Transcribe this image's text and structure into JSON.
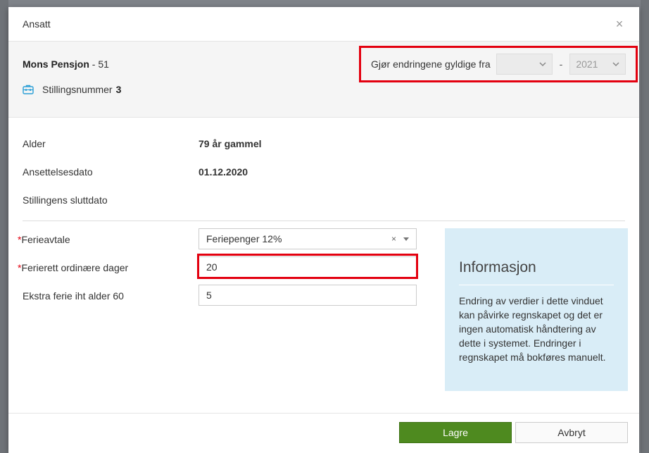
{
  "modal": {
    "title": "Ansatt",
    "close_symbol": "×"
  },
  "employee": {
    "name": "Mons Pensjon",
    "number_suffix": " - 51",
    "position_label": "Stillingsnummer",
    "position_number": "3"
  },
  "validity": {
    "label": "Gjør endringene gyldige fra",
    "month_value": "",
    "separator": "-",
    "year_value": "2021"
  },
  "details": [
    {
      "label": "Alder",
      "value": "79 år gammel"
    },
    {
      "label": "Ansettelsesdato",
      "value": "01.12.2020"
    },
    {
      "label": "Stillingens sluttdato",
      "value": ""
    }
  ],
  "form": {
    "ferieavtale": {
      "label": "Ferieavtale",
      "value": "Feriepenger 12%",
      "clear": "×"
    },
    "ferierett": {
      "label": "Ferierett ordinære dager",
      "value": "20"
    },
    "ekstra": {
      "label": "Ekstra ferie iht alder 60",
      "value": "5"
    },
    "required_mark": "*"
  },
  "info": {
    "title": "Informasjon",
    "text": "Endring av verdier i dette vinduet kan påvirke regnskapet og det er ingen automatisk håndtering av dette i systemet. Endringer i regnskapet må bokføres manuelt."
  },
  "footer": {
    "save_label": "Lagre",
    "cancel_label": "Avbryt"
  },
  "colors": {
    "accent_red": "#e3000f",
    "save_green": "#4e8a1f",
    "info_bg": "#d9edf7"
  }
}
